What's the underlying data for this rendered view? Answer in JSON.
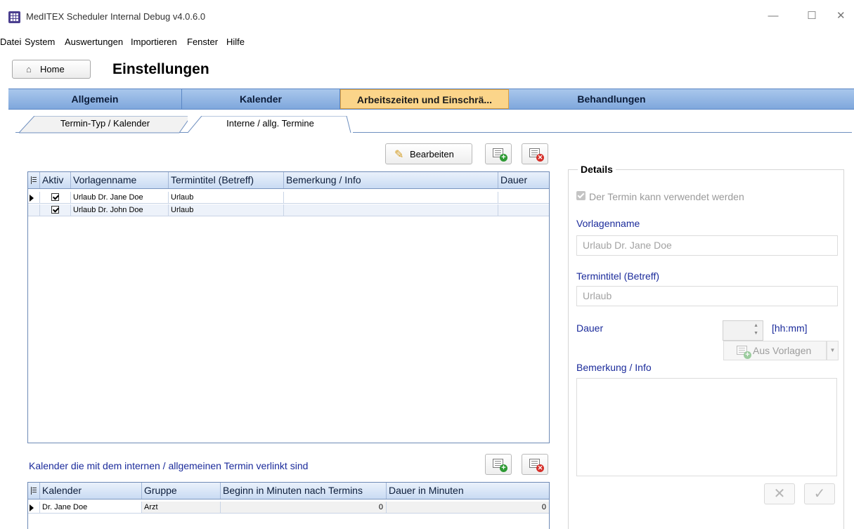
{
  "window": {
    "title": "MedITEX Scheduler Internal Debug v4.0.6.0",
    "minimize": "—",
    "maximize": "☐",
    "close": "✕"
  },
  "menu": [
    "Datei",
    "System",
    "Auswertungen",
    "Importieren",
    "Fenster",
    "Hilfe"
  ],
  "home_button": "Home",
  "page_title": "Einstellungen",
  "main_tabs": [
    {
      "label": "Allgemein"
    },
    {
      "label": "Kalender"
    },
    {
      "label": "Arbeitszeiten und Einschrä..."
    },
    {
      "label": "Behandlungen"
    }
  ],
  "active_main_tab": "Arbeitszeiten und Einschrä...",
  "sub_tabs": [
    {
      "label": "Termin-Typ / Kalender"
    },
    {
      "label": "Interne / allg. Termine"
    }
  ],
  "toolbar": {
    "edit_label": "Bearbeiten"
  },
  "templates_grid": {
    "columns": [
      "Aktiv",
      "Vorlagenname",
      "Termintitel (Betreff)",
      "Bemerkung / Info",
      "Dauer"
    ],
    "rows": [
      {
        "active": true,
        "name": "Urlaub Dr. Jane Doe",
        "title": "Urlaub",
        "note": "",
        "duration": "",
        "selected": true
      },
      {
        "active": true,
        "name": "Urlaub Dr. John Doe",
        "title": "Urlaub",
        "note": "",
        "duration": "",
        "selected": false
      }
    ]
  },
  "linked_label": "Kalender die mit dem internen / allgemeinen Termin verlinkt sind",
  "calendar_grid": {
    "columns": [
      "Kalender",
      "Gruppe",
      "Beginn in Minuten nach Termins",
      "Dauer in Minuten"
    ],
    "rows": [
      {
        "calendar": "Dr. Jane Doe",
        "group": "Arzt",
        "begin": "0",
        "duration": "0"
      }
    ]
  },
  "details": {
    "title": "Details",
    "usable_label": "Der Termin kann verwendet werden",
    "usable_checked": true,
    "template_name_label": "Vorlagenname",
    "template_name_value": "Urlaub Dr. Jane Doe",
    "subject_label": "Termintitel (Betreff)",
    "subject_value": "Urlaub",
    "duration_label": "Dauer",
    "duration_unit": "[hh:mm]",
    "from_templates_label": "Aus Vorlagen",
    "note_label": "Bemerkung / Info",
    "cancel_symbol": "✕",
    "ok_symbol": "✓"
  }
}
